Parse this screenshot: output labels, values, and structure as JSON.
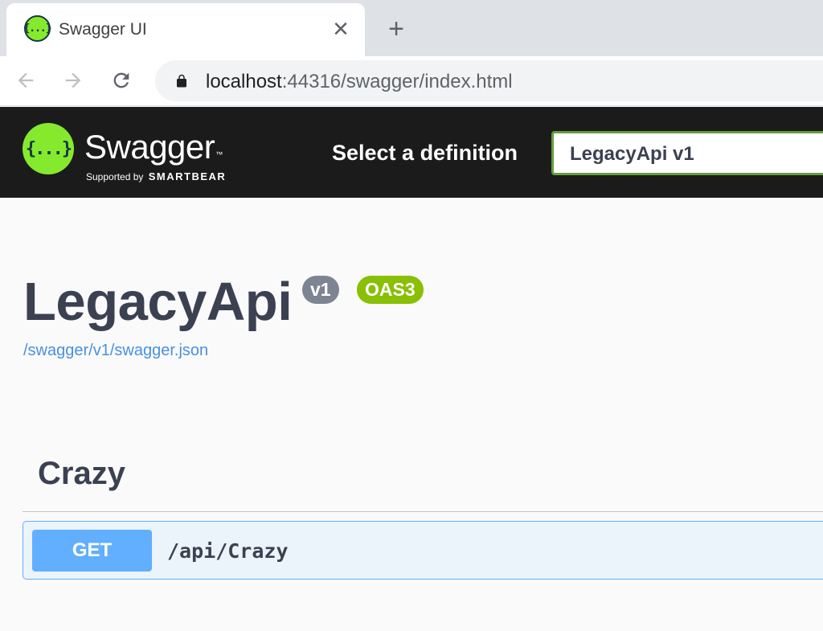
{
  "browser": {
    "tab_title": "Swagger UI",
    "tab_favicon_text": "{...}",
    "close_glyph": "✕",
    "new_tab_glyph": "+",
    "url_host": "localhost",
    "url_path": ":44316/swagger/index.html"
  },
  "topbar": {
    "logo_glyph": "{...}",
    "brand": "Swagger",
    "brand_tm": "™",
    "supported_by": "Supported by",
    "smartbear": "SMARTBEAR",
    "definition_label": "Select a definition",
    "definition_selected": "LegacyApi v1"
  },
  "info": {
    "title": "LegacyApi",
    "version_badge": "v1",
    "oas_badge": "OAS3",
    "spec_url": "/swagger/v1/swagger.json"
  },
  "tags": [
    {
      "name": "Crazy",
      "operations": [
        {
          "method": "GET",
          "path": "/api/Crazy"
        }
      ]
    }
  ],
  "colors": {
    "swagger_green": "#85ea2d",
    "topbar_bg": "#1b1b1b",
    "get_blue": "#61affe",
    "oas_badge": "#89bf04",
    "version_badge": "#7d8492",
    "link": "#4990e2"
  },
  "icons": {
    "back": "arrow-left-icon",
    "forward": "arrow-right-icon",
    "reload": "reload-icon",
    "lock": "lock-icon"
  }
}
